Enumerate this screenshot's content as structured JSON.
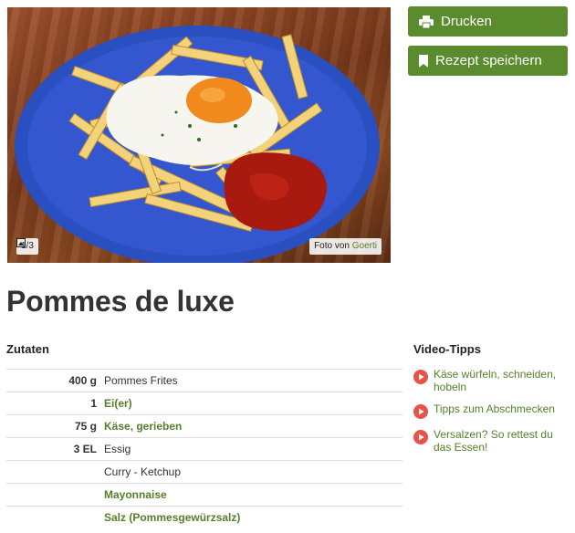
{
  "photo": {
    "counter": "1/3",
    "credit_prefix": "Foto von",
    "credit_author": "Goerti"
  },
  "actions": {
    "print_label": "Drucken",
    "save_label": "Rezept speichern"
  },
  "recipe": {
    "title": "Pommes de luxe"
  },
  "ingredients": {
    "heading": "Zutaten",
    "rows": [
      {
        "amount": "400 g",
        "name": "Pommes Frites",
        "link": false
      },
      {
        "amount": "1",
        "name": "Ei(er)",
        "link": true
      },
      {
        "amount": "75 g",
        "name": "Käse, gerieben",
        "link": true
      },
      {
        "amount": "3 EL",
        "name": "Essig",
        "link": false
      },
      {
        "amount": "",
        "name": "Curry - Ketchup",
        "link": false
      },
      {
        "amount": "",
        "name": "Mayonnaise",
        "link": true
      },
      {
        "amount": "",
        "name": "Salz (Pommesgewürzsalz)",
        "link": true
      }
    ]
  },
  "video_tips": {
    "heading": "Video-Tipps",
    "items": [
      "Käse würfeln, schneiden, hobeln",
      "Tipps zum Abschmecken",
      "Versalzen? So rettest du das Essen!"
    ]
  },
  "colors": {
    "brand_green": "#5a8c2e",
    "link_green": "#55802a",
    "play_red": "#e8524a"
  },
  "icons": [
    "printer-icon",
    "bookmark-icon",
    "gallery-icon",
    "play-icon"
  ]
}
